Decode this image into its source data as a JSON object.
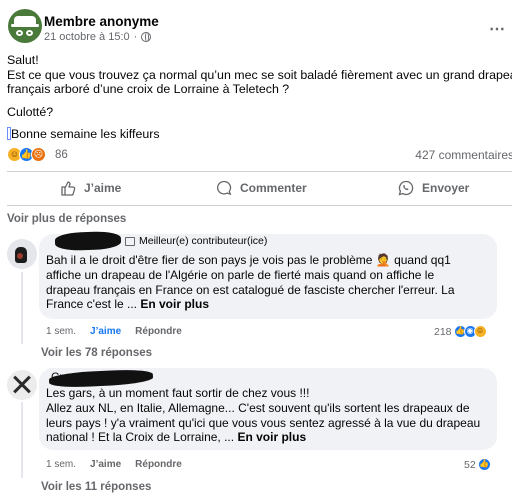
{
  "post": {
    "author": "Membre anonyme",
    "timestamp": "21 octobre à 15:0",
    "more_icon": "⋯",
    "lines": [
      "Salut!",
      "Est ce que vous trouvez ça normal qu’un mec se soit baladé fièrement avec un grand drapeau",
      "français arboré d’une croix de Lorraine à Teletech ?"
    ],
    "line_culotte": "Culotté?",
    "line_bonne": "Bonne semaine les kiffeurs",
    "reaction_count": "86",
    "comment_count": "427 commentaires"
  },
  "actions": {
    "like": "J’aime",
    "comment": "Commenter",
    "share": "Envoyer"
  },
  "see_more_replies": "Voir plus de réponses",
  "comments": [
    {
      "badge": "Meilleur(e) contributeur(ice)",
      "lines": [
        "Bah il a le droit d'être fier de son pays je vois pas le problème 🤦 quand qq1",
        "affiche un drapeau de l'Algérie on parle de fierté mais quand on affiche le",
        "drapeau français en France on est catalogué de fasciste chercher l'erreur. La"
      ],
      "last_line": "France c'est le ...",
      "voir_plus": "En voir plus",
      "time": "1 sem.",
      "like": "J’aime",
      "reply": "Répondre",
      "reaction_count": "218",
      "view_replies": "Voir les 78 réponses"
    },
    {
      "name_fragment": "Cr",
      "lines": [
        "Les gars, à un moment faut sortir de chez vous !!!",
        "Allez aux NL, en Italie, Allemagne... C'est souvent qu'ils sortent les drapeaux de",
        "leurs pays ! y'a vraiment qu'ici que vous vous sentez agressé à la vue du drapeau"
      ],
      "last_line": "national ! Et la Croix de Lorraine, ...",
      "voir_plus": "En voir plus",
      "time": "1 sem.",
      "like": "J’aime",
      "reply": "Répondre",
      "reaction_count": "52",
      "view_replies": "Voir les 11 réponses"
    }
  ],
  "colors": {
    "accent": "#1877f2",
    "secondary_text": "#65676b",
    "bubble": "#f0f2f5"
  }
}
